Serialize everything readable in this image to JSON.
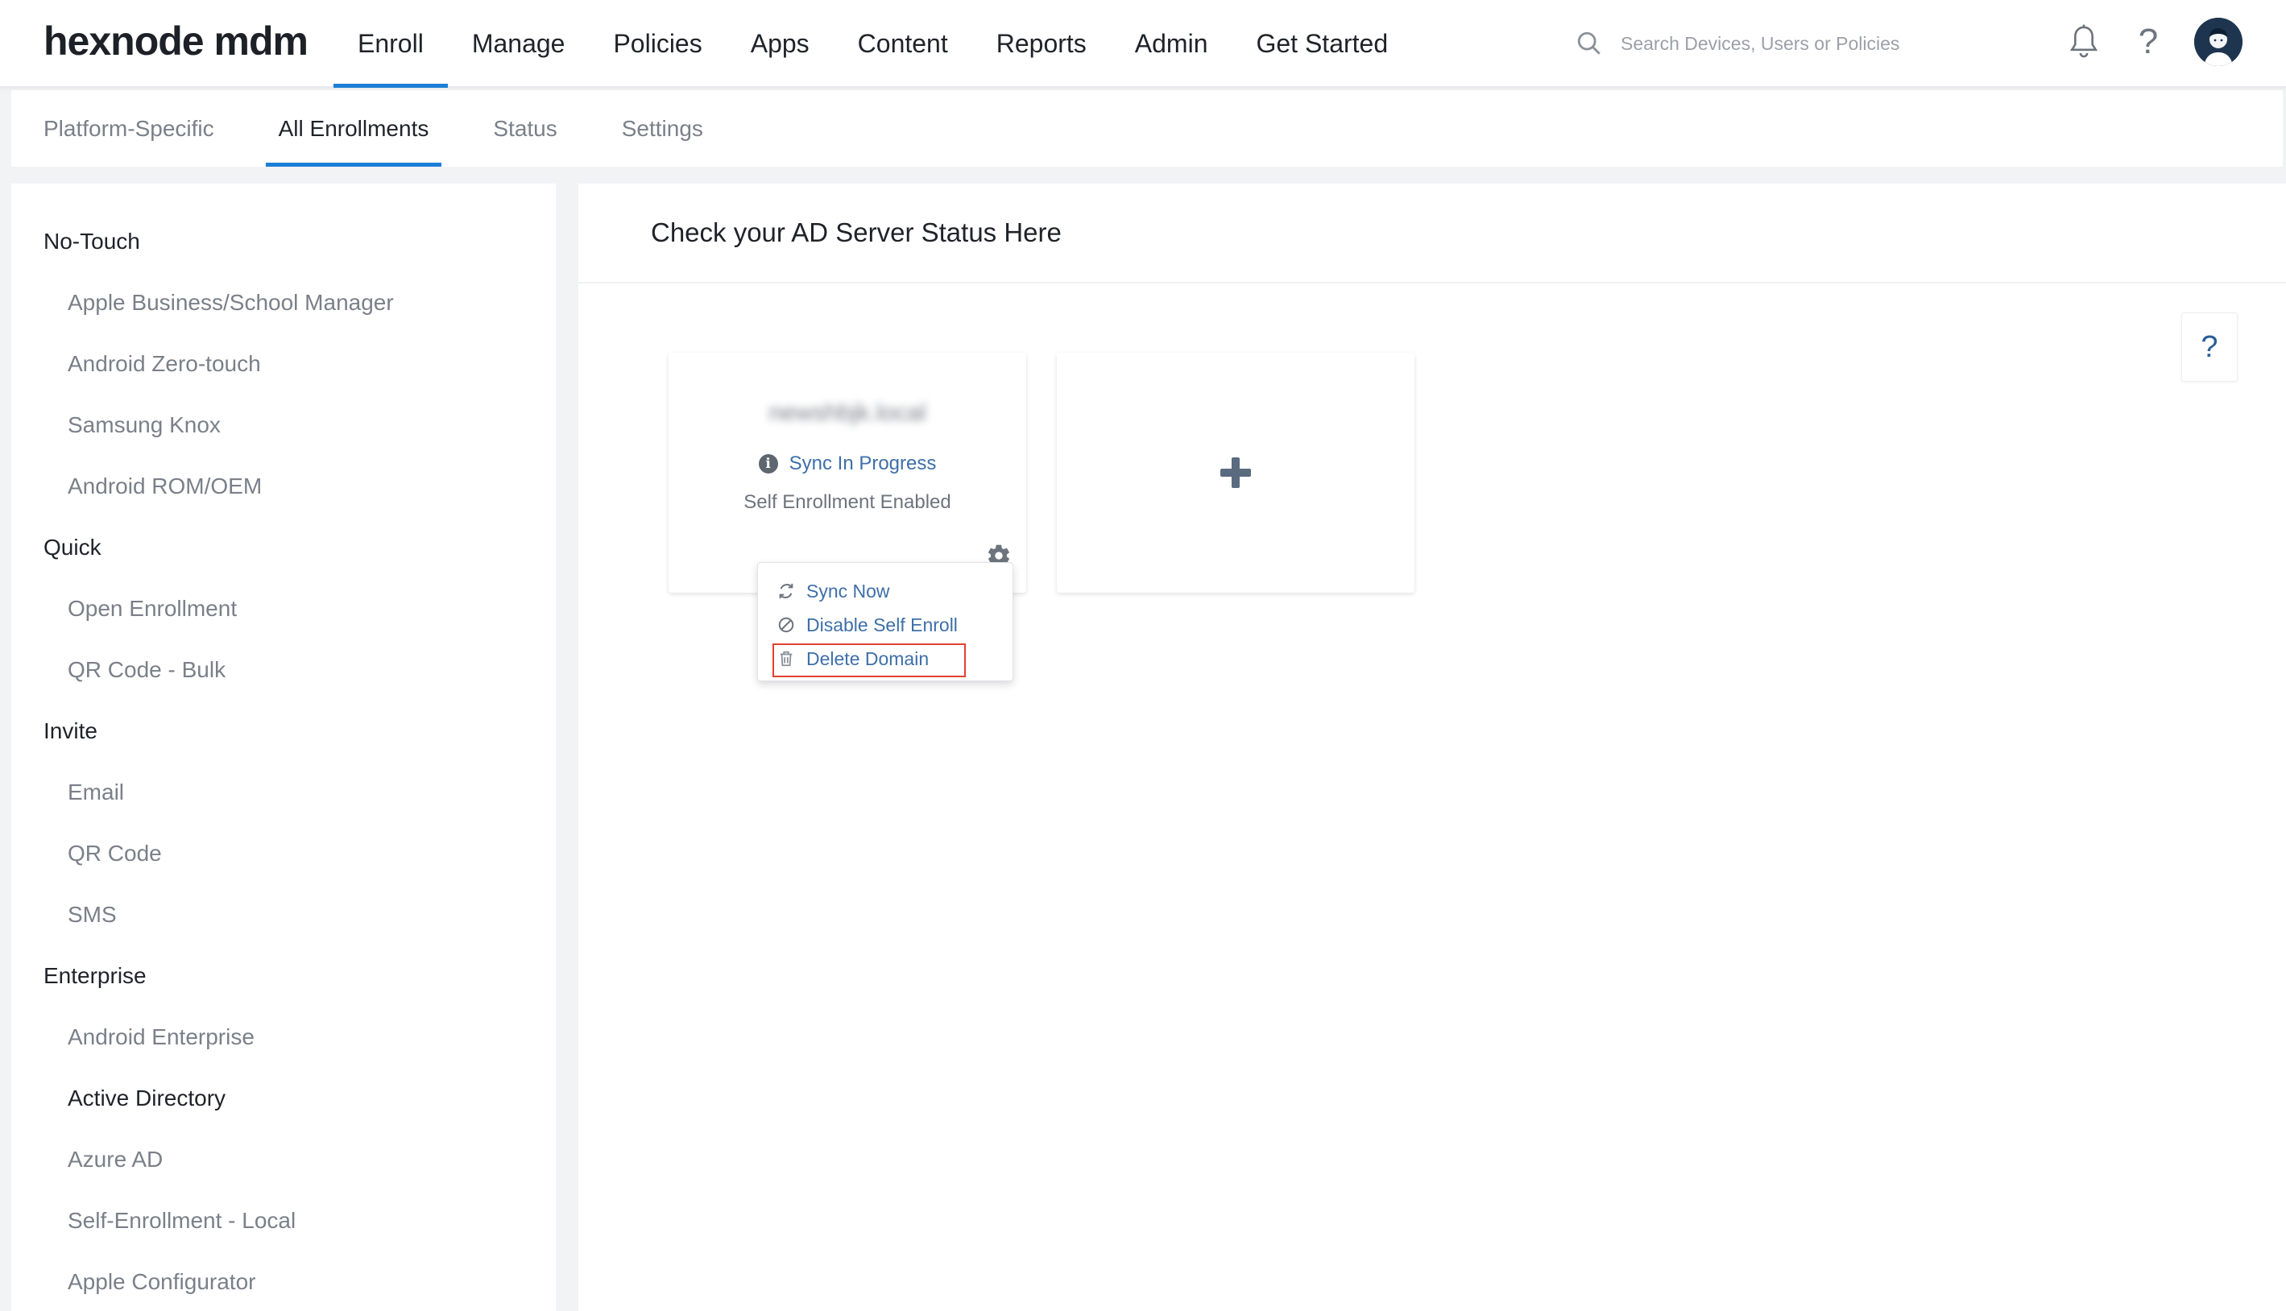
{
  "app": {
    "logo_text": "hexnode mdm"
  },
  "top_nav": {
    "items": [
      {
        "label": "Enroll",
        "active": true
      },
      {
        "label": "Manage"
      },
      {
        "label": "Policies"
      },
      {
        "label": "Apps"
      },
      {
        "label": "Content"
      },
      {
        "label": "Reports"
      },
      {
        "label": "Admin"
      },
      {
        "label": "Get Started"
      }
    ],
    "search_placeholder": "Search Devices, Users or Policies",
    "icons": [
      "search-icon",
      "bell-icon",
      "help-icon",
      "avatar"
    ]
  },
  "sub_nav": {
    "items": [
      {
        "label": "Platform-Specific"
      },
      {
        "label": "All Enrollments",
        "active": true
      },
      {
        "label": "Status"
      },
      {
        "label": "Settings"
      }
    ]
  },
  "sidebar": {
    "groups": [
      {
        "label": "No-Touch",
        "items": [
          "Apple Business/School Manager",
          "Android Zero-touch",
          "Samsung Knox",
          "Android ROM/OEM"
        ]
      },
      {
        "label": "Quick",
        "items": [
          "Open Enrollment",
          "QR Code - Bulk"
        ]
      },
      {
        "label": "Invite",
        "items": [
          "Email",
          "QR Code",
          "SMS"
        ]
      },
      {
        "label": "Enterprise",
        "items": [
          "Android Enterprise",
          "Active Directory",
          "Azure AD",
          "Self-Enrollment - Local",
          "Apple Configurator"
        ]
      }
    ],
    "active_item": "Active Directory"
  },
  "main": {
    "title": "Check your AD Server Status Here",
    "help_label": "?",
    "domain_card": {
      "domain_name": "newshbjk.local",
      "sync_status": "Sync In Progress",
      "self_enroll_status": "Self Enrollment Enabled"
    },
    "add_card": {
      "icon": "plus-icon"
    },
    "dropdown": {
      "items": [
        {
          "label": "Sync Now",
          "icon": "sync-icon"
        },
        {
          "label": "Disable Self Enroll",
          "icon": "disable-icon"
        },
        {
          "label": "Delete Domain",
          "icon": "trash-icon",
          "highlighted": true
        }
      ]
    }
  },
  "colors": {
    "accent": "#1a7fd6",
    "link": "#3e6fa8",
    "highlight_border": "#e0412f"
  }
}
